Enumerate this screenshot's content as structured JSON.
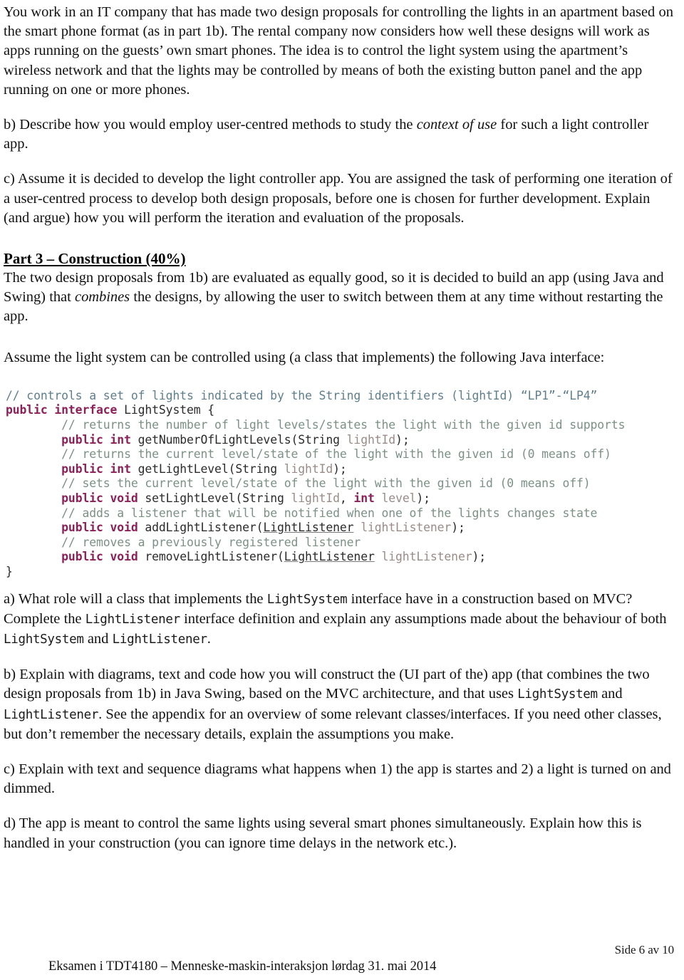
{
  "document": {
    "body_paragraphs": {
      "intro": "You work in an IT company that has made two design proposals for controlling the lights in an apartment based on the smart phone format (as in part 1b). The rental company now considers how well these designs will work as apps running on the guests’ own smart phones. The idea is to control the light system using the apartment’s wireless network and that the lights may be controlled by means of both the existing button panel and the app running on one or more phones.",
      "task_b_part2_pre": "b) Describe how you would employ user-centred methods to study the ",
      "task_b_part2_em": "context of use",
      "task_b_part2_post": " for such a light controller app.",
      "task_c_part2": "c) Assume it is decided to develop the light controller app. You are assigned the task of performing one iteration of a user-centred process to develop both design proposals, before one is chosen for further development. Explain (and argue) how you will perform the iteration and evaluation of the proposals.",
      "part3_heading": "Part 3 – Construction (40%)",
      "part3_intro_pre": "The two design proposals from 1b) are evaluated as equally good, so it is decided to build an app (using Java and Swing) that ",
      "part3_intro_em": "combines",
      "part3_intro_post": " the designs, by allowing the user to switch between them at any time without restarting the app.",
      "assume_para": "Assume the light system can be controlled using (a class that implements) the following Java interface:",
      "task_a_pre": "a) What role will a class that implements the ",
      "task_a_code1": "LightSystem",
      "task_a_mid1": " interface have in a construction based on MVC? Complete the ",
      "task_a_code2": "LightListener",
      "task_a_mid2": " interface definition and explain any assumptions made about the behaviour of both ",
      "task_a_code3": "LightSystem",
      "task_a_mid3": " and ",
      "task_a_code4": "LightListener",
      "task_a_post": ".",
      "task_b_pre": "b) Explain with diagrams, text and code how you will construct the (UI part of the) app (that combines the two design proposals from 1b) in Java Swing, based on the MVC architecture, and that uses ",
      "task_b_code1": "LightSystem",
      "task_b_mid1": " and ",
      "task_b_code2": "LightListener",
      "task_b_post": ". See the appendix for an overview of some relevant classes/interfaces. If you need other classes, but don’t remember the necessary details, explain the assumptions you make.",
      "task_c": "c) Explain with text and sequence diagrams what happens when 1) the app is startes  and 2) a light is turned on and dimmed.",
      "task_d": "d) The app is meant to control the same lights using several smart phones simultaneously. Explain how this is handled in your construction (you can ignore time delays in the network etc.)."
    },
    "code_block": {
      "language": "java",
      "lines": [
        {
          "indent": 0,
          "tokens": [
            {
              "t": "cmt1",
              "s": "// controls a set of lights indicated by the String identifiers (lightId) “LP1”-“LP4”"
            }
          ]
        },
        {
          "indent": 0,
          "tokens": [
            {
              "t": "kw",
              "s": "public interface"
            },
            {
              "t": "id",
              "s": " LightSystem {"
            }
          ]
        },
        {
          "indent": 1,
          "tokens": [
            {
              "t": "cmt",
              "s": "// returns the number of light levels/states the light with the given id supports"
            }
          ]
        },
        {
          "indent": 1,
          "tokens": [
            {
              "t": "kw",
              "s": "public int"
            },
            {
              "t": "id",
              "s": " getNumberOfLightLevels("
            },
            {
              "t": "typ",
              "s": "String"
            },
            {
              "t": "var",
              "s": " lightId"
            },
            {
              "t": "punc",
              "s": ");"
            }
          ]
        },
        {
          "indent": 1,
          "tokens": [
            {
              "t": "cmt",
              "s": "// returns the current level/state of the light with the given id (0 means off)"
            }
          ]
        },
        {
          "indent": 1,
          "tokens": [
            {
              "t": "kw",
              "s": "public int"
            },
            {
              "t": "id",
              "s": " getLightLevel("
            },
            {
              "t": "typ",
              "s": "String"
            },
            {
              "t": "var",
              "s": " lightId"
            },
            {
              "t": "punc",
              "s": ");"
            }
          ]
        },
        {
          "indent": 1,
          "tokens": [
            {
              "t": "cmt",
              "s": "// sets the current level/state of the light with the given id (0 means off)"
            }
          ]
        },
        {
          "indent": 1,
          "tokens": [
            {
              "t": "kw",
              "s": "public void"
            },
            {
              "t": "id",
              "s": " setLightLevel("
            },
            {
              "t": "typ",
              "s": "String"
            },
            {
              "t": "var",
              "s": " lightId"
            },
            {
              "t": "punc",
              "s": ", "
            },
            {
              "t": "kw",
              "s": "int"
            },
            {
              "t": "var",
              "s": " level"
            },
            {
              "t": "punc",
              "s": ");"
            }
          ]
        },
        {
          "indent": 1,
          "tokens": [
            {
              "t": "cmt",
              "s": "// adds a listener that will be notified when one of the lights changes state"
            }
          ]
        },
        {
          "indent": 1,
          "tokens": [
            {
              "t": "kw",
              "s": "public void"
            },
            {
              "t": "id",
              "s": " addLightListener("
            },
            {
              "t": "typ uline",
              "s": "LightListener"
            },
            {
              "t": "var",
              "s": " lightListener"
            },
            {
              "t": "punc",
              "s": ");"
            }
          ]
        },
        {
          "indent": 1,
          "tokens": [
            {
              "t": "cmt",
              "s": "// removes a previously registered listener"
            }
          ]
        },
        {
          "indent": 1,
          "tokens": [
            {
              "t": "kw",
              "s": "public void"
            },
            {
              "t": "id",
              "s": " removeLightListener("
            },
            {
              "t": "typ uline",
              "s": "LightListener"
            },
            {
              "t": "var",
              "s": " lightListener"
            },
            {
              "t": "punc",
              "s": ");"
            }
          ]
        },
        {
          "indent": 0,
          "tokens": [
            {
              "t": "punc",
              "s": "}"
            }
          ]
        }
      ]
    },
    "footer": {
      "page_label": "Side 6 av 10",
      "exam_line": "Eksamen i TDT4180 – Menneske-maskin-interaksjon lørdag 31. mai 2014"
    }
  }
}
